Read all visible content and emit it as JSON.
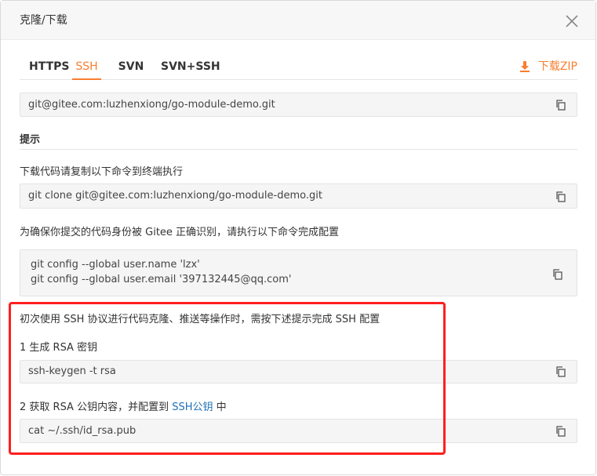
{
  "dialog": {
    "title": "克隆/下载"
  },
  "tabs": [
    {
      "label": "HTTPS",
      "active": false
    },
    {
      "label": "SSH",
      "active": true
    },
    {
      "label": "SVN",
      "active": false
    },
    {
      "label": "SVN+SSH",
      "active": false
    }
  ],
  "download": {
    "label": "下载ZIP",
    "icon": "download-icon"
  },
  "repo_url": "git@gitee.com:luzhenxiong/go-module-demo.git",
  "tips": {
    "title": "提示",
    "clone_hint": "下载代码请复制以下命令到终端执行",
    "clone_command": "git clone git@gitee.com:luzhenxiong/go-module-demo.git",
    "config_hint": "为确保你提交的代码身份被 Gitee 正确识别，请执行以下命令完成配置",
    "config_line1": "git config --global user.name 'lzx'",
    "config_line2": "git config --global user.email '397132445@qq.com'",
    "ssh_hint": "初次使用 SSH 协议进行代码克隆、推送等操作时，需按下述提示完成 SSH 配置",
    "step1_label": "1 生成 RSA 密钥",
    "step1_command": "ssh-keygen -t rsa",
    "step2_label_prefix": "2 获取 RSA 公钥内容，并配置到",
    "step2_link": "SSH公钥",
    "step2_label_suffix": "中",
    "step2_command": "cat ~/.ssh/id_rsa.pub"
  },
  "colors": {
    "accent": "#fa7d2f",
    "link": "#1f6fb5",
    "highlight": "#ff1f1f"
  }
}
